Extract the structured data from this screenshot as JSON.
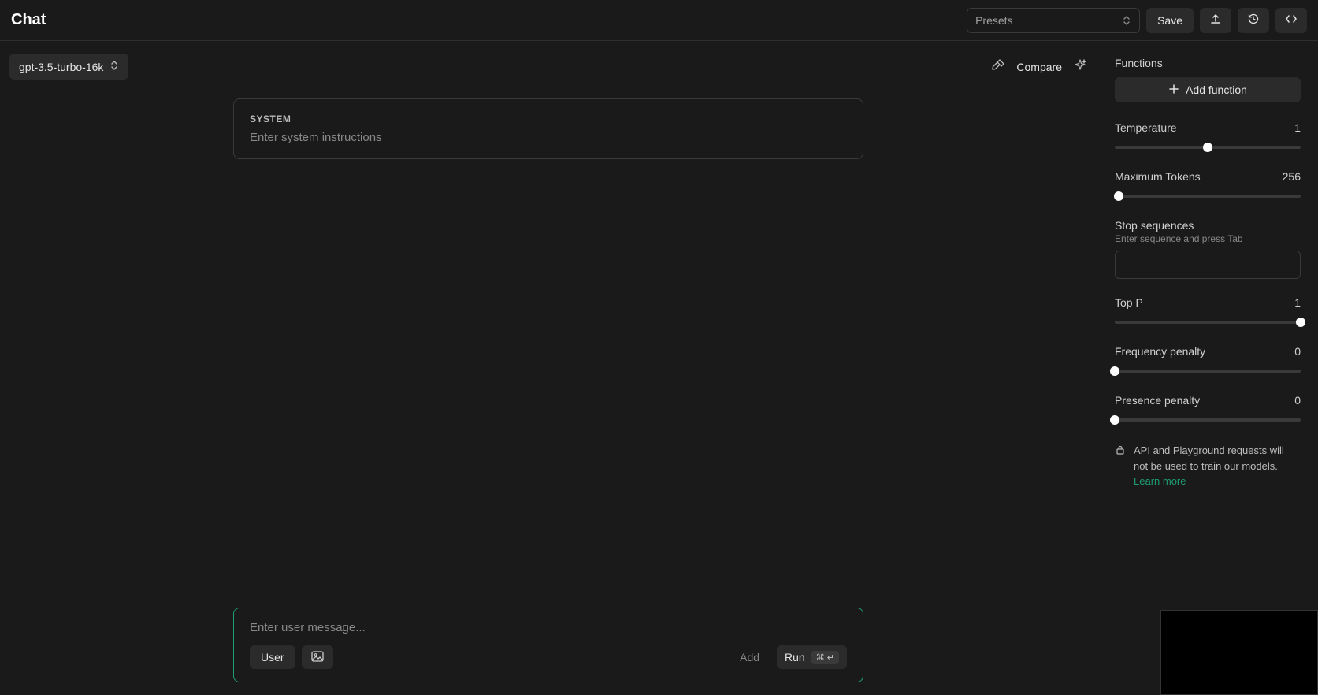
{
  "header": {
    "title": "Chat",
    "presets_placeholder": "Presets",
    "save_label": "Save"
  },
  "model": {
    "name": "gpt-3.5-turbo-16k"
  },
  "compare": {
    "label": "Compare"
  },
  "system": {
    "label": "SYSTEM",
    "placeholder": "Enter system instructions"
  },
  "user_box": {
    "placeholder": "Enter user message...",
    "user_label": "User",
    "add_label": "Add",
    "run_label": "Run",
    "shortcut": "⌘ ↵"
  },
  "sidebar": {
    "functions_label": "Functions",
    "add_function_label": "Add function",
    "temperature": {
      "label": "Temperature",
      "value": "1",
      "pct": 50
    },
    "max_tokens": {
      "label": "Maximum Tokens",
      "value": "256",
      "pct": 2
    },
    "stop_seq": {
      "label": "Stop sequences",
      "hint": "Enter sequence and press Tab"
    },
    "top_p": {
      "label": "Top P",
      "value": "1",
      "pct": 100
    },
    "freq_penalty": {
      "label": "Frequency penalty",
      "value": "0",
      "pct": 0
    },
    "pres_penalty": {
      "label": "Presence penalty",
      "value": "0",
      "pct": 0
    },
    "notice_text": "API and Playground requests will not be used to train our models.",
    "learn_more": "Learn more"
  }
}
